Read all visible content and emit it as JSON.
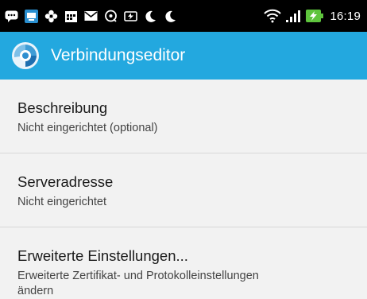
{
  "status_bar": {
    "time": "16:19",
    "left_icons": [
      "message-icon",
      "app-icon",
      "flower-icon",
      "calendar-icon",
      "mail-icon",
      "location-icon",
      "battery-saver-icon",
      "moon-icon",
      "moon-icon"
    ],
    "right_icons": [
      "wifi-icon",
      "signal-icon",
      "battery-charging-icon"
    ]
  },
  "app_bar": {
    "title": "Verbindungseditor",
    "color": "#23a8df"
  },
  "settings": [
    {
      "title": "Beschreibung",
      "subtitle": "Nicht eingerichtet (optional)"
    },
    {
      "title": "Serveradresse",
      "subtitle": "Nicht eingerichtet"
    },
    {
      "title": "Erweiterte Einstellungen...",
      "subtitle_line1": "Erweiterte Zertifikat- und Protokolleinstellungen",
      "subtitle_line2": "ändern"
    }
  ]
}
